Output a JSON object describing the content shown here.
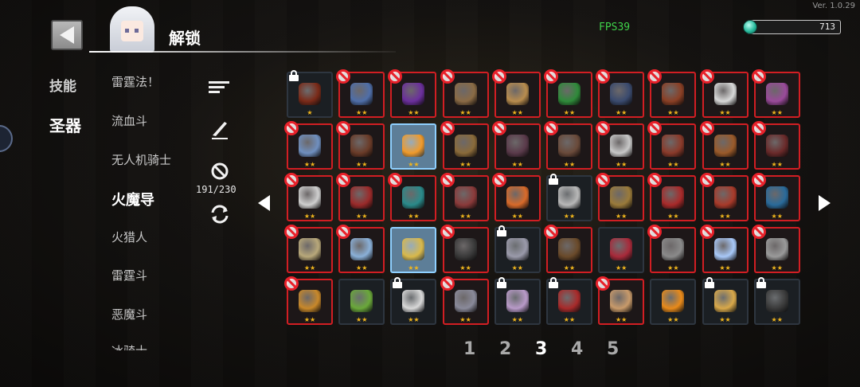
{
  "version": "Ver. 1.0.29",
  "fps": "FPS39",
  "gems": "713",
  "header": {
    "title": "解锁"
  },
  "categories": [
    "技能",
    "圣器"
  ],
  "active_category": 1,
  "left_bubble": "22",
  "heroes": [
    "雷霆法！",
    "流血斗",
    "无人机骑士",
    "火魔导",
    "火猎人",
    "雷霆斗",
    "恶魔斗",
    "冰骑士"
  ],
  "selected_hero": 3,
  "tools": {
    "count": "191/230"
  },
  "pagination": {
    "pages": [
      "1",
      "2",
      "3",
      "4",
      "5"
    ],
    "current": 2
  },
  "colors": {
    "ban": "#e8212a",
    "stars": "#f0b51c",
    "fps": "#3fd34a",
    "selected_border": "#8fd0ff"
  },
  "grid": {
    "rows": [
      [
        {
          "state": "padlock",
          "stars": "★",
          "icon": "dark-vortex-icon",
          "color": "#7a2a18"
        },
        {
          "state": "banned",
          "stars": "★★",
          "icon": "crystal-cluster-icon",
          "color": "#4f6ea8"
        },
        {
          "state": "banned",
          "stars": "★★",
          "icon": "purple-blob-icon",
          "color": "#6b2f9c"
        },
        {
          "state": "banned",
          "stars": "★★",
          "icon": "tower-icon",
          "color": "#8a6a45"
        },
        {
          "state": "banned",
          "stars": "★★",
          "icon": "shell-icon",
          "color": "#b88c4e"
        },
        {
          "state": "banned",
          "stars": "★★",
          "icon": "green-book-icon",
          "color": "#2f8a3a"
        },
        {
          "state": "banned",
          "stars": "★★",
          "icon": "bottle-icon",
          "color": "#3a4a6e"
        },
        {
          "state": "banned",
          "stars": "★★",
          "icon": "round-shield-icon",
          "color": "#8a3f25"
        },
        {
          "state": "banned",
          "stars": "★★",
          "icon": "dice-icon",
          "color": "#d8d8d8"
        },
        {
          "state": "banned",
          "stars": "★★",
          "icon": "spellbook-icon",
          "color": "#9a4a9a"
        }
      ],
      [
        {
          "state": "banned",
          "stars": "★★",
          "icon": "blue-claw-icon",
          "color": "#6f8fbf"
        },
        {
          "state": "banned",
          "stars": "★★",
          "icon": "horned-helmet-icon",
          "color": "#6a3b28"
        },
        {
          "state": "selected",
          "stars": "★★",
          "icon": "orange-orb-icon",
          "color": "#f09a2a"
        },
        {
          "state": "banned",
          "stars": "★★",
          "icon": "sword-icon",
          "color": "#8a6a3a"
        },
        {
          "state": "banned",
          "stars": "★★",
          "icon": "quill-icon",
          "color": "#5a3a4a"
        },
        {
          "state": "banned",
          "stars": "★★",
          "icon": "ankh-icon",
          "color": "#6a4a3a"
        },
        {
          "state": "banned",
          "stars": "★★",
          "icon": "pixel-burst-icon",
          "color": "#c8c8c8"
        },
        {
          "state": "banned",
          "stars": "★★",
          "icon": "barrel-icon",
          "color": "#8a3a2a"
        },
        {
          "state": "banned",
          "stars": "★★",
          "icon": "gauntlet-icon",
          "color": "#9a5a2a"
        },
        {
          "state": "banned",
          "stars": "★★",
          "icon": "red-egg-icon",
          "color": "#6a2a2a"
        }
      ],
      [
        {
          "state": "banned",
          "stars": "★★",
          "icon": "skull-icon",
          "color": "#cfcfcf"
        },
        {
          "state": "banned",
          "stars": "★★",
          "icon": "red-cloth-icon",
          "color": "#9a2a2a"
        },
        {
          "state": "banned",
          "stars": "★★",
          "icon": "teal-card-icon",
          "color": "#2a8a8a"
        },
        {
          "state": "banned",
          "stars": "★★",
          "icon": "meat-icon",
          "color": "#8a3a3a"
        },
        {
          "state": "banned",
          "stars": "★★",
          "icon": "carrot-icon",
          "color": "#d86a2a"
        },
        {
          "state": "padlock",
          "stars": "★★",
          "icon": "paper-icon",
          "color": "#b8b8b8"
        },
        {
          "state": "banned",
          "stars": "★★",
          "icon": "boot-icon",
          "color": "#9a7a3a"
        },
        {
          "state": "banned",
          "stars": "★★",
          "icon": "red-feather-icon",
          "color": "#a82a2a"
        },
        {
          "state": "banned",
          "stars": "★★",
          "icon": "red-ring-icon",
          "color": "#a83a2a"
        },
        {
          "state": "banned",
          "stars": "★★",
          "icon": "blue-flame-icon",
          "color": "#2a6a9a"
        }
      ],
      [
        {
          "state": "banned",
          "stars": "★★",
          "icon": "mask-icon",
          "color": "#b8a87a"
        },
        {
          "state": "banned",
          "stars": "★★",
          "icon": "ice-rock-icon",
          "color": "#8ab0d8"
        },
        {
          "state": "selected",
          "stars": "★★",
          "icon": "eggs-nest-icon",
          "color": "#d8b84a"
        },
        {
          "state": "banned",
          "stars": "★★",
          "icon": "dark-eye-icon",
          "color": "#3a3a3a"
        },
        {
          "state": "padlock",
          "stars": "★★",
          "icon": "crescent-blade-icon",
          "color": "#9a9aaa"
        },
        {
          "state": "banned",
          "stars": "★★",
          "icon": "pants-icon",
          "color": "#6a4a2a"
        },
        {
          "state": "plain",
          "stars": "★★",
          "icon": "red-wings-icon",
          "color": "#a82a3a"
        },
        {
          "state": "banned",
          "stars": "★★",
          "icon": "chain-icon",
          "color": "#8a8a8a"
        },
        {
          "state": "banned",
          "stars": "★★",
          "icon": "blue-apple-icon",
          "color": "#a8c8f8"
        },
        {
          "state": "banned",
          "stars": "★★",
          "icon": "stone-icon",
          "color": "#9a9a9a"
        }
      ],
      [
        {
          "state": "banned",
          "stars": "★★",
          "icon": "medal-icon",
          "color": "#c8882a"
        },
        {
          "state": "plain",
          "stars": "★★",
          "icon": "leaf-icon",
          "color": "#6aa83a"
        },
        {
          "state": "padlock",
          "stars": "★★",
          "icon": "cloud-icon",
          "color": "#d8d8d8"
        },
        {
          "state": "banned",
          "stars": "★★",
          "icon": "swirl-icon",
          "color": "#8a8a9a"
        },
        {
          "state": "padlock",
          "stars": "★★",
          "icon": "crystal-icon",
          "color": "#b89ac8"
        },
        {
          "state": "padlock",
          "stars": "★★",
          "icon": "red-urn-icon",
          "color": "#a82a2a"
        },
        {
          "state": "banned",
          "stars": "★★",
          "icon": "peace-sign-icon",
          "color": "#c89a6a"
        },
        {
          "state": "plain",
          "stars": "★★",
          "icon": "orange-fruit-icon",
          "color": "#e88a1a"
        },
        {
          "state": "padlock",
          "stars": "★★",
          "icon": "golden-boomerang-icon",
          "color": "#d8a84a"
        },
        {
          "state": "padlock",
          "stars": "★★",
          "icon": "black-hood-icon",
          "color": "#3a3a3a"
        }
      ]
    ]
  }
}
